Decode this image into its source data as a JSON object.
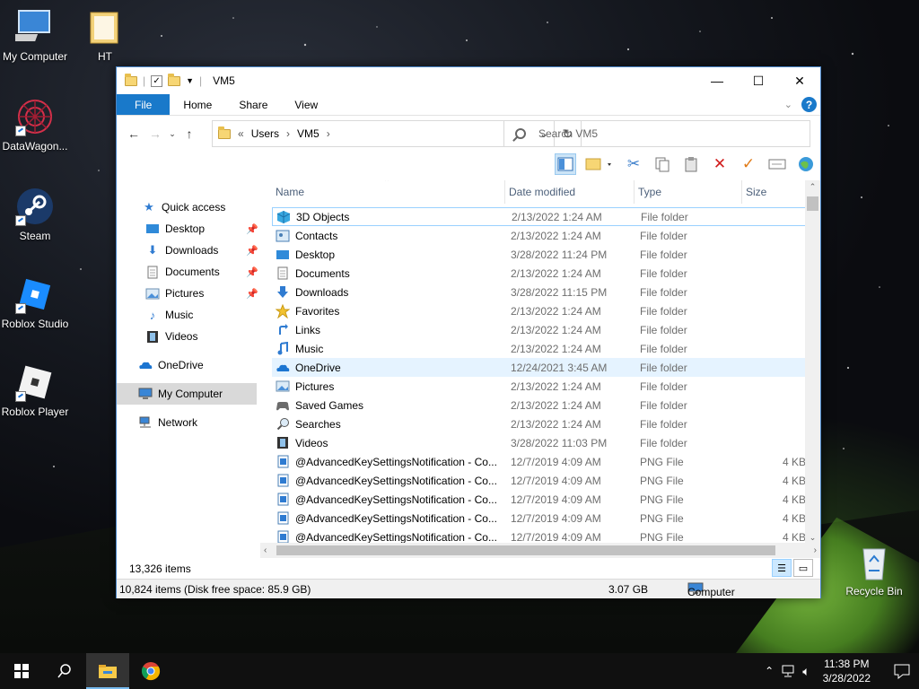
{
  "desktop": {
    "icons": [
      {
        "label": "My Computer",
        "icon": "computer-icon"
      },
      {
        "label": "HT",
        "icon": "folder-icon"
      },
      {
        "label": "DataWagon...",
        "icon": "datawagon-icon"
      },
      {
        "label": "Steam",
        "icon": "steam-icon"
      },
      {
        "label": "Roblox Studio",
        "icon": "roblox-studio-icon"
      },
      {
        "label": "Roblox Player",
        "icon": "roblox-player-icon"
      },
      {
        "label": "Recycle Bin",
        "icon": "recycle-bin-icon"
      }
    ]
  },
  "window": {
    "title": "VM5",
    "controls": {
      "minimize": "—",
      "maximize": "☐",
      "close": "✕"
    },
    "ribbon_tabs": [
      "File",
      "Home",
      "Share",
      "View"
    ],
    "address": {
      "overflow": "«",
      "crumbs": [
        "Users",
        "VM5"
      ],
      "separator": "›"
    },
    "search_placeholder": "Search VM5",
    "nav": {
      "quick_access": "Quick access",
      "quick_items": [
        {
          "label": "Desktop",
          "pinned": true
        },
        {
          "label": "Downloads",
          "pinned": true
        },
        {
          "label": "Documents",
          "pinned": true
        },
        {
          "label": "Pictures",
          "pinned": true
        },
        {
          "label": "Music",
          "pinned": false
        },
        {
          "label": "Videos",
          "pinned": false
        }
      ],
      "onedrive": "OneDrive",
      "my_computer": "My Computer",
      "network": "Network"
    },
    "columns": {
      "name": "Name",
      "date": "Date modified",
      "type": "Type",
      "size": "Size"
    },
    "rows": [
      {
        "name": "3D Objects",
        "date": "2/13/2022 1:24 AM",
        "type": "File folder",
        "size": "",
        "icon": "3d-objects-icon"
      },
      {
        "name": "Contacts",
        "date": "2/13/2022 1:24 AM",
        "type": "File folder",
        "size": "",
        "icon": "contacts-icon"
      },
      {
        "name": "Desktop",
        "date": "3/28/2022 11:24 PM",
        "type": "File folder",
        "size": "",
        "icon": "desktop-folder-icon"
      },
      {
        "name": "Documents",
        "date": "2/13/2022 1:24 AM",
        "type": "File folder",
        "size": "",
        "icon": "documents-icon"
      },
      {
        "name": "Downloads",
        "date": "3/28/2022 11:15 PM",
        "type": "File folder",
        "size": "",
        "icon": "downloads-icon"
      },
      {
        "name": "Favorites",
        "date": "2/13/2022 1:24 AM",
        "type": "File folder",
        "size": "",
        "icon": "favorites-icon"
      },
      {
        "name": "Links",
        "date": "2/13/2022 1:24 AM",
        "type": "File folder",
        "size": "",
        "icon": "links-icon"
      },
      {
        "name": "Music",
        "date": "2/13/2022 1:24 AM",
        "type": "File folder",
        "size": "",
        "icon": "music-icon"
      },
      {
        "name": "OneDrive",
        "date": "12/24/2021 3:45 AM",
        "type": "File folder",
        "size": "",
        "icon": "onedrive-icon"
      },
      {
        "name": "Pictures",
        "date": "2/13/2022 1:24 AM",
        "type": "File folder",
        "size": "",
        "icon": "pictures-icon"
      },
      {
        "name": "Saved Games",
        "date": "2/13/2022 1:24 AM",
        "type": "File folder",
        "size": "",
        "icon": "saved-games-icon"
      },
      {
        "name": "Searches",
        "date": "2/13/2022 1:24 AM",
        "type": "File folder",
        "size": "",
        "icon": "searches-icon"
      },
      {
        "name": "Videos",
        "date": "3/28/2022 11:03 PM",
        "type": "File folder",
        "size": "",
        "icon": "videos-icon"
      },
      {
        "name": "@AdvancedKeySettingsNotification - Co...",
        "date": "12/7/2019 4:09 AM",
        "type": "PNG File",
        "size": "4 KB",
        "icon": "png-file-icon"
      },
      {
        "name": "@AdvancedKeySettingsNotification - Co...",
        "date": "12/7/2019 4:09 AM",
        "type": "PNG File",
        "size": "4 KB",
        "icon": "png-file-icon"
      },
      {
        "name": "@AdvancedKeySettingsNotification - Co...",
        "date": "12/7/2019 4:09 AM",
        "type": "PNG File",
        "size": "4 KB",
        "icon": "png-file-icon"
      },
      {
        "name": "@AdvancedKeySettingsNotification - Co...",
        "date": "12/7/2019 4:09 AM",
        "type": "PNG File",
        "size": "4 KB",
        "icon": "png-file-icon"
      },
      {
        "name": "@AdvancedKeySettingsNotification - Co...",
        "date": "12/7/2019 4:09 AM",
        "type": "PNG File",
        "size": "4 KB",
        "icon": "png-file-icon"
      }
    ],
    "status_items": "13,326 items",
    "info": {
      "items": "10,824 items (Disk free space: 85.9 GB)",
      "size": "3.07 GB",
      "location": "Computer"
    }
  },
  "taskbar": {
    "time": "11:38 PM",
    "date": "3/28/2022"
  },
  "colors": {
    "accent": "#1979ca",
    "selection": "#e5f3ff",
    "taskbar": "#101010"
  }
}
